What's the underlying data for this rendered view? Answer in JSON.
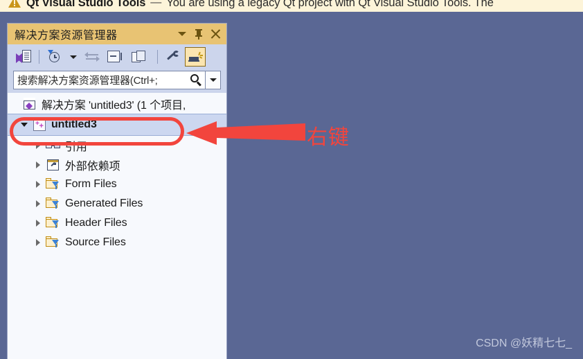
{
  "banner": {
    "icon": "warning-triangle-icon",
    "title": "Qt Visual Studio Tools",
    "dash": "—",
    "message": "You are using a legacy Qt project with Qt Visual Studio Tools. The"
  },
  "panel": {
    "title": "解决方案资源管理器",
    "title_buttons": [
      {
        "name": "panel-menu-button",
        "icon": "chevron-down-icon"
      },
      {
        "name": "panel-pin-button",
        "icon": "pin-icon"
      },
      {
        "name": "panel-close-button",
        "icon": "close-icon"
      }
    ],
    "toolbar": [
      {
        "name": "sync-with-active-document-button",
        "icon": "sync-document-icon"
      },
      {
        "name": "pending-changes-filter-button",
        "icon": "clock-filter-icon"
      },
      {
        "name": "pending-changes-filter-dropdown",
        "icon": "chevron-down-icon"
      },
      {
        "name": "navigate-backward-forward-button",
        "icon": "navigate-arrows-icon"
      },
      {
        "name": "collapse-all-button",
        "icon": "collapse-all-icon"
      },
      {
        "name": "show-all-files-button",
        "icon": "show-all-files-icon"
      },
      {
        "name": "properties-button",
        "icon": "wrench-icon"
      },
      {
        "name": "preview-selected-items-button",
        "icon": "preview-pane-icon"
      }
    ],
    "search": {
      "placeholder": "搜索解决方案资源管理器(Ctrl+;",
      "value": "",
      "icon": "search-icon",
      "dropdown_icon": "chevron-down-icon"
    },
    "tree": [
      {
        "label": "解决方案 'untitled3' (1 个项目,",
        "icon": "solution-icon",
        "expander": "none",
        "indent": 0,
        "selected": false
      },
      {
        "label": "untitled3",
        "icon": "cpp-project-icon",
        "expander": "expanded",
        "indent": 1,
        "selected": true
      },
      {
        "label": "引用",
        "icon": "references-icon",
        "expander": "collapsed",
        "indent": 2,
        "selected": false
      },
      {
        "label": "外部依赖项",
        "icon": "external-dependencies-icon",
        "expander": "collapsed",
        "indent": 2,
        "selected": false
      },
      {
        "label": "Form Files",
        "icon": "filter-folder-icon",
        "expander": "collapsed",
        "indent": 2,
        "selected": false
      },
      {
        "label": "Generated Files",
        "icon": "filter-folder-icon",
        "expander": "collapsed",
        "indent": 2,
        "selected": false
      },
      {
        "label": "Header Files",
        "icon": "filter-folder-icon",
        "expander": "collapsed",
        "indent": 2,
        "selected": false
      },
      {
        "label": "Source Files",
        "icon": "filter-folder-icon",
        "expander": "collapsed",
        "indent": 2,
        "selected": false
      }
    ]
  },
  "annotations": {
    "highlight_shape": "red-oval",
    "arrow": "red-left-arrow",
    "text": "右键",
    "color": "#f2453d"
  },
  "watermark": {
    "text": "CSDN @妖精七七_"
  },
  "colors": {
    "background": "#5a6794",
    "panel_background": "#f7f9fd",
    "panel_title_bar": "#e8c373",
    "toolbar": "#ccd5ec",
    "selection": "#ccd7f0",
    "annotation_red": "#f2453d",
    "banner_background": "#fdf4d9"
  }
}
